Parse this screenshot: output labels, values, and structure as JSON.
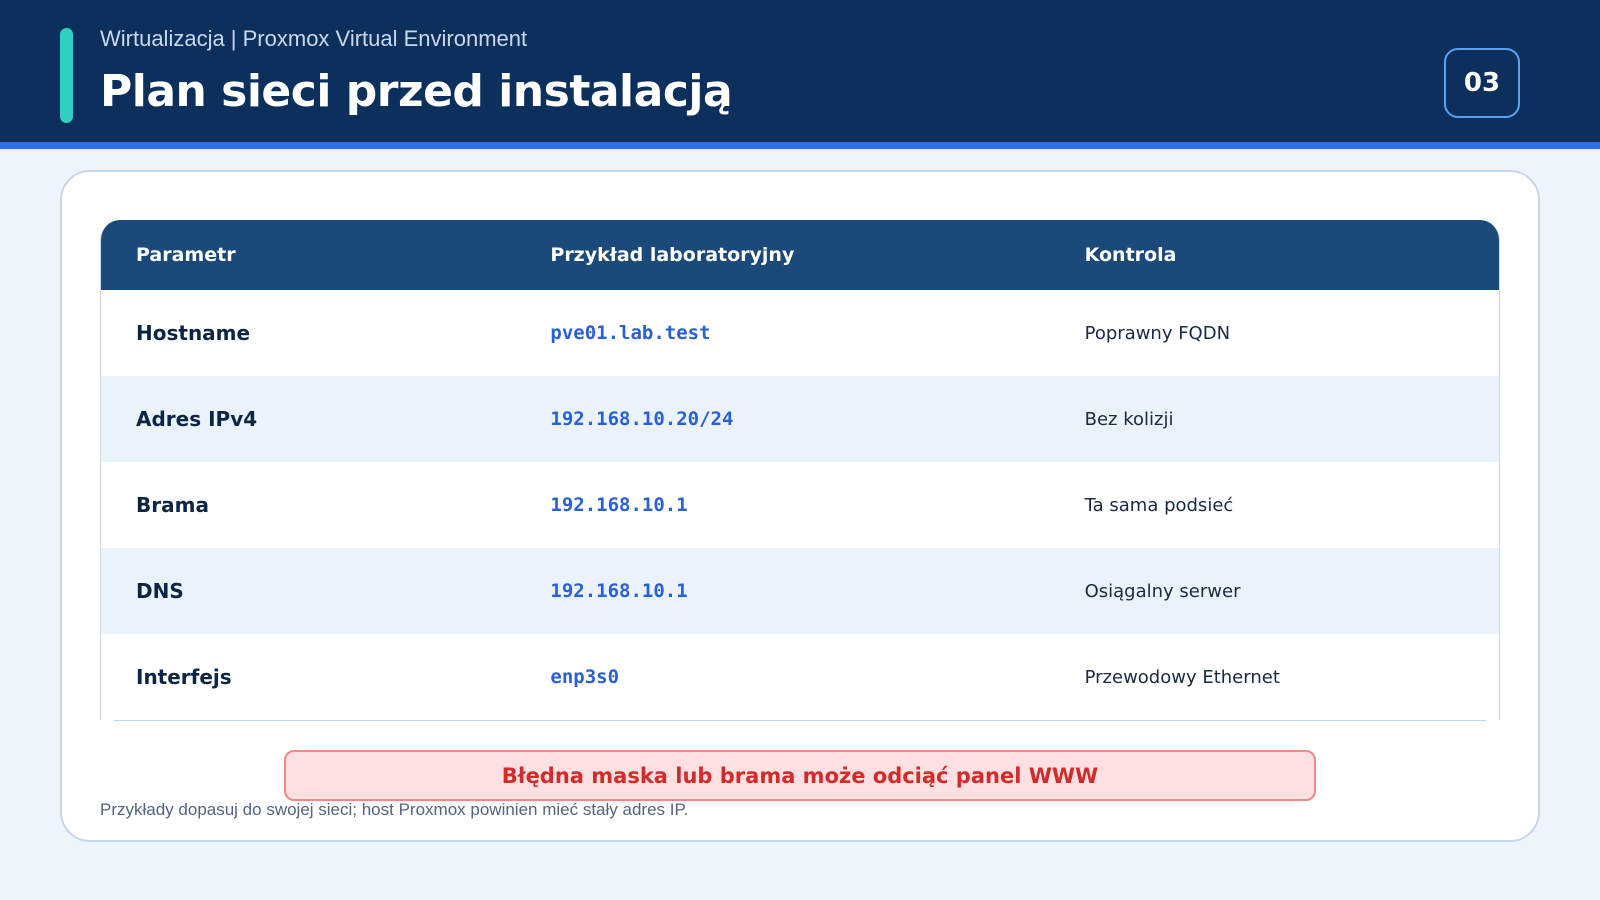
{
  "header": {
    "subtitle": "Wirtualizacja | Proxmox Virtual Environment",
    "title": "Plan sieci przed instalacją",
    "page_number": "03"
  },
  "table": {
    "columns": [
      "Parametr",
      "Przykład laboratoryjny",
      "Kontrola"
    ],
    "rows": [
      {
        "param": "Hostname",
        "value": "pve01.lab.test",
        "check": "Poprawny FQDN"
      },
      {
        "param": "Adres IPv4",
        "value": "192.168.10.20/24",
        "check": "Bez kolizji"
      },
      {
        "param": "Brama",
        "value": "192.168.10.1",
        "check": "Ta sama podsieć"
      },
      {
        "param": "DNS",
        "value": "192.168.10.1",
        "check": "Osiągalny serwer"
      },
      {
        "param": "Interfejs",
        "value": "enp3s0",
        "check": "Przewodowy Ethernet"
      }
    ]
  },
  "warning": "Błędna maska lub brama może odciąć panel WWW",
  "footnote": "Przykłady dopasuj do swojej sieci; host Proxmox powinien mieć stały adres IP.",
  "colors": {
    "header_bg": "#0c2f5c",
    "accent": "#2fd0c0",
    "table_header_bg": "#1b4a7a",
    "value_text": "#2a5fd6",
    "warning_text": "#d12b2b"
  }
}
